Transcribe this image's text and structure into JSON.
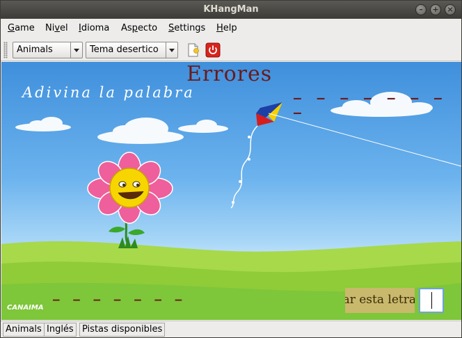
{
  "window": {
    "title": "KHangMan"
  },
  "menubar": {
    "items": [
      {
        "mnemonic": "G",
        "rest": "ame"
      },
      {
        "prefix": "Ni",
        "mnemonic": "v",
        "rest": "el"
      },
      {
        "mnemonic": "I",
        "rest": "dioma"
      },
      {
        "prefix": "As",
        "mnemonic": "p",
        "rest": "ecto"
      },
      {
        "mnemonic": "S",
        "rest": "ettings"
      },
      {
        "mnemonic": "H",
        "rest": "elp"
      }
    ]
  },
  "toolbar": {
    "category_value": "Animals",
    "theme_value": "Tema desertico",
    "new_icon": "new-document-icon",
    "quit_icon": "power-icon"
  },
  "game": {
    "guess_label": "Adivina la palabra",
    "errors_label": "Errores",
    "missed_letters_dashes": "— — — — — — — —",
    "word_dashes": "— — — — — — —",
    "try_letter_prompt": "Jugar esta letra",
    "letter_input_value": "",
    "logo_text": "CANAIMA"
  },
  "statusbar": {
    "category": "Animals",
    "language": "Inglés",
    "hints": "Pistas disponibles"
  },
  "colors": {
    "titlebar": "#3c3b37",
    "sky": "#5aa6e8",
    "grass": "#7ec63a",
    "errors_text": "#6a1a1a",
    "prompt_bg": "#c9b96c"
  }
}
